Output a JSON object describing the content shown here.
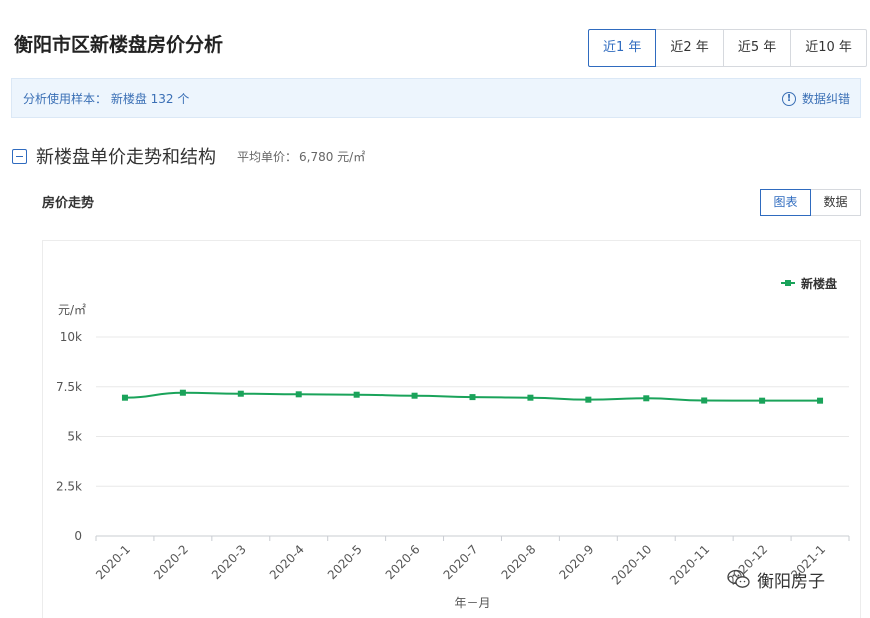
{
  "header": {
    "title": "衡阳市区新楼盘房价分析",
    "period_tabs": [
      "近1 年",
      "近2 年",
      "近5 年",
      "近10 年"
    ],
    "active_period": "近1 年"
  },
  "sample_bar": {
    "text": "分析使用样本：  新楼盘 132 个",
    "correction_label": "数据纠错"
  },
  "section": {
    "title": "新楼盘单价走势和结构",
    "avg_label": "平均单价：",
    "avg_value": "6,780 元/㎡"
  },
  "chart_panel": {
    "title": "房价走势",
    "view_buttons": [
      "图表",
      "数据"
    ],
    "active_view": "图表"
  },
  "chart_data": {
    "type": "line",
    "title": "房价走势",
    "ylabel": "元/㎡",
    "xlabel": "年－月",
    "ylim": [
      0,
      10000
    ],
    "yticks": [
      0,
      2500,
      5000,
      7500,
      10000
    ],
    "ytick_labels": [
      "0",
      "2.5k",
      "5k",
      "7.5k",
      "10k"
    ],
    "grid": "horizontal",
    "legend": "top-right",
    "categories": [
      "2020-1",
      "2020-2",
      "2020-3",
      "2020-4",
      "2020-5",
      "2020-6",
      "2020-7",
      "2020-8",
      "2020-9",
      "2020-10",
      "2020-11",
      "2020-12",
      "2021-1"
    ],
    "series": [
      {
        "name": "新楼盘",
        "color": "#1aa35a",
        "values": [
          6950,
          7200,
          7150,
          7120,
          7100,
          7050,
          6980,
          6950,
          6850,
          6920,
          6810,
          6800,
          6800
        ]
      }
    ]
  },
  "watermark": {
    "text": "衡阳房子",
    "icon": "wechat-icon"
  }
}
